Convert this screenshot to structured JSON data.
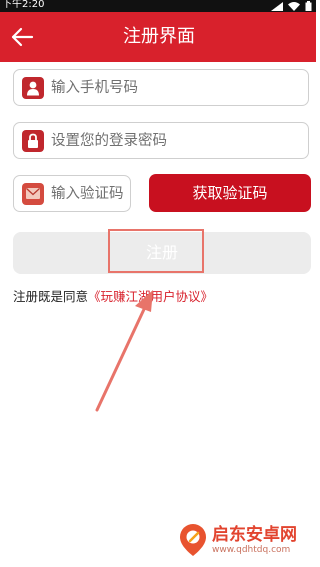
{
  "status_bar": {
    "time": "下午2:20"
  },
  "header": {
    "title": "注册界面",
    "back_icon": "arrow-left-icon"
  },
  "form": {
    "phone_placeholder": "输入手机号码",
    "password_placeholder": "设置您的登录密码",
    "code_placeholder": "输入验证码",
    "get_code_label": "获取验证码",
    "register_label": "注册"
  },
  "agreement": {
    "prefix": "注册既是同意",
    "link": "《玩赚江湖用户协议》"
  },
  "watermark": {
    "text": "启东安卓网",
    "url": "www.qdhtdq.com"
  },
  "colors": {
    "brand": "#d8212c",
    "button": "#c8101f",
    "disabled": "#ececec",
    "annotation": "#e8746a"
  }
}
